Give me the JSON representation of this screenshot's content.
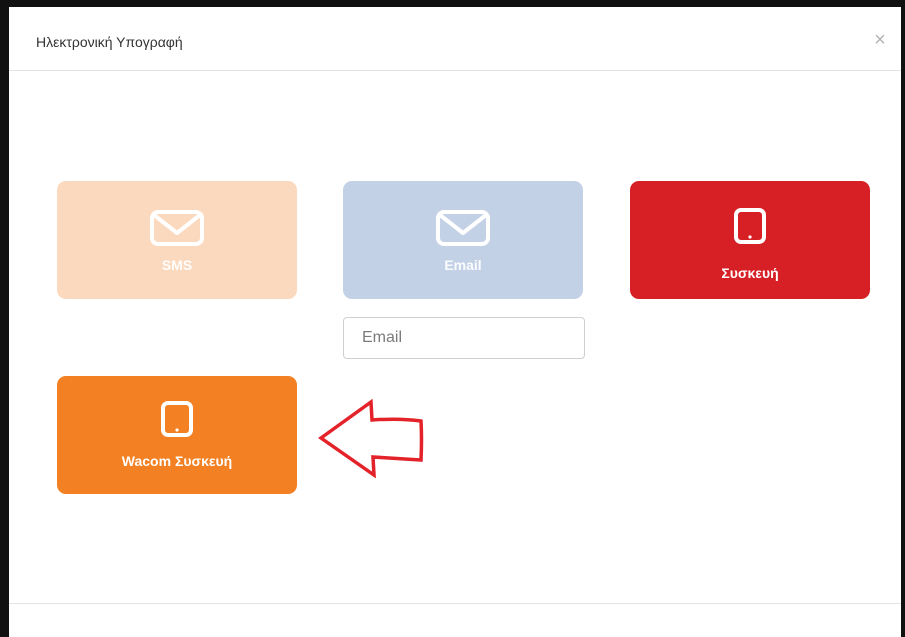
{
  "modal": {
    "title": "Ηλεκτρονική Υπογραφή",
    "close_glyph": "×"
  },
  "options": {
    "sms": {
      "label": "SMS",
      "icon": "envelope-icon",
      "color": "#fbd9bf"
    },
    "email": {
      "label": "Email",
      "icon": "envelope-icon",
      "color": "#c3d1e6"
    },
    "device": {
      "label": "Συσκευή",
      "icon": "tablet-icon",
      "color": "#d71f26"
    },
    "wacom": {
      "label": "Wacom Συσκευή",
      "icon": "tablet-icon",
      "color": "#f38022"
    }
  },
  "email_field": {
    "placeholder": "Email",
    "value": ""
  },
  "annotation": {
    "icon": "arrow-left-icon",
    "color": "#e3222a"
  }
}
